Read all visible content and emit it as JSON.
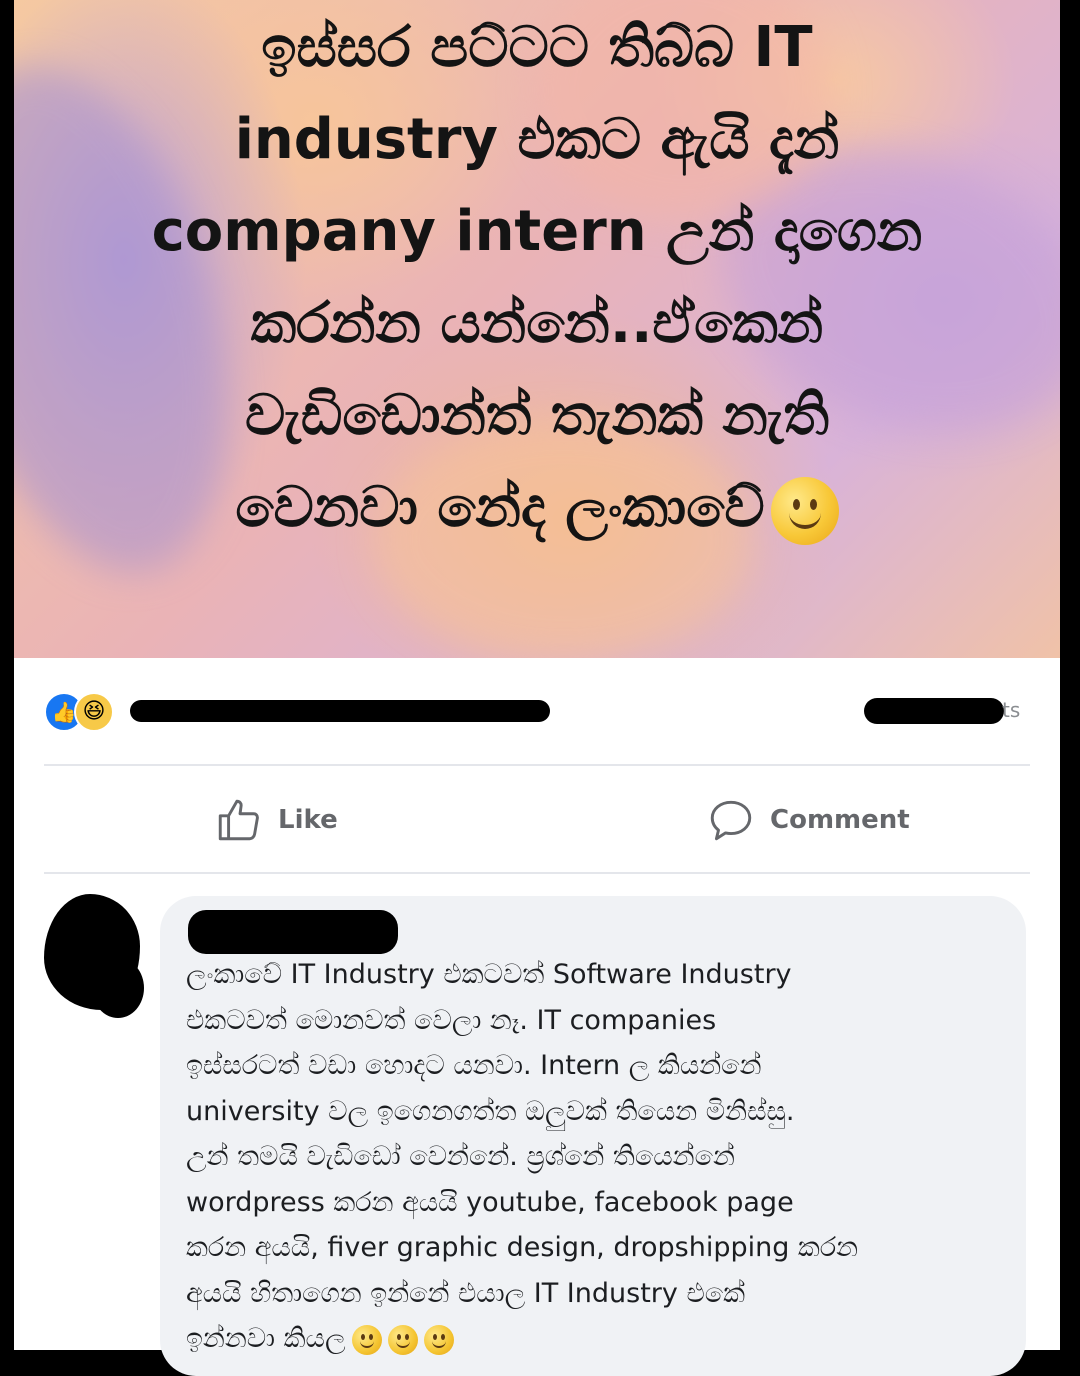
{
  "post": {
    "image_text_lines": [
      "ඉස්සර පට්ටට තිබ්බ IT",
      "industry එකට ඇයි දැන්",
      "company intern උන් දාගෙන",
      "කරන්න යන්නේ..ඒකෙන්",
      "වැඩිඩොන්ත් තැනක් නැති",
      "වෙනවා නේද ලංකාවේ"
    ],
    "image_emoji": "slightly-smiling-face",
    "reactions": {
      "icons": [
        "like-icon",
        "haha-icon"
      ],
      "count_suffix": "ts"
    }
  },
  "actions": {
    "like_label": "Like",
    "comment_label": "Comment"
  },
  "comment": {
    "lines": [
      "ලංකාවේ IT Industry එකටවත් Software Industry",
      "එකටවත් මොනවත් වෙලා නෑ. IT companies",
      "ඉස්සරටත් වඩා හොදට යනවා.  Intern ල කියන්නේ",
      "university වල ඉගෙනගත්ත ඔලුවක් තියෙන මිනිස්සු.",
      "උන් තමයි වැඩිඩෝ වෙන්නේ. ප්‍රශ්නේ තියෙන්නේ",
      "wordpress කරන අයයි youtube, facebook page",
      "කරන අයයි, fiver graphic design, dropshipping කරන",
      "අයයි  හිතාගෙන ඉන්නේ එයාල IT Industry එකේ",
      "ඉන්නවා කියල"
    ],
    "trailing_emoji_count": 3
  },
  "colors": {
    "facebook_blue": "#1877f2",
    "bubble_bg": "#f0f2f5",
    "secondary_text": "#65676b"
  }
}
